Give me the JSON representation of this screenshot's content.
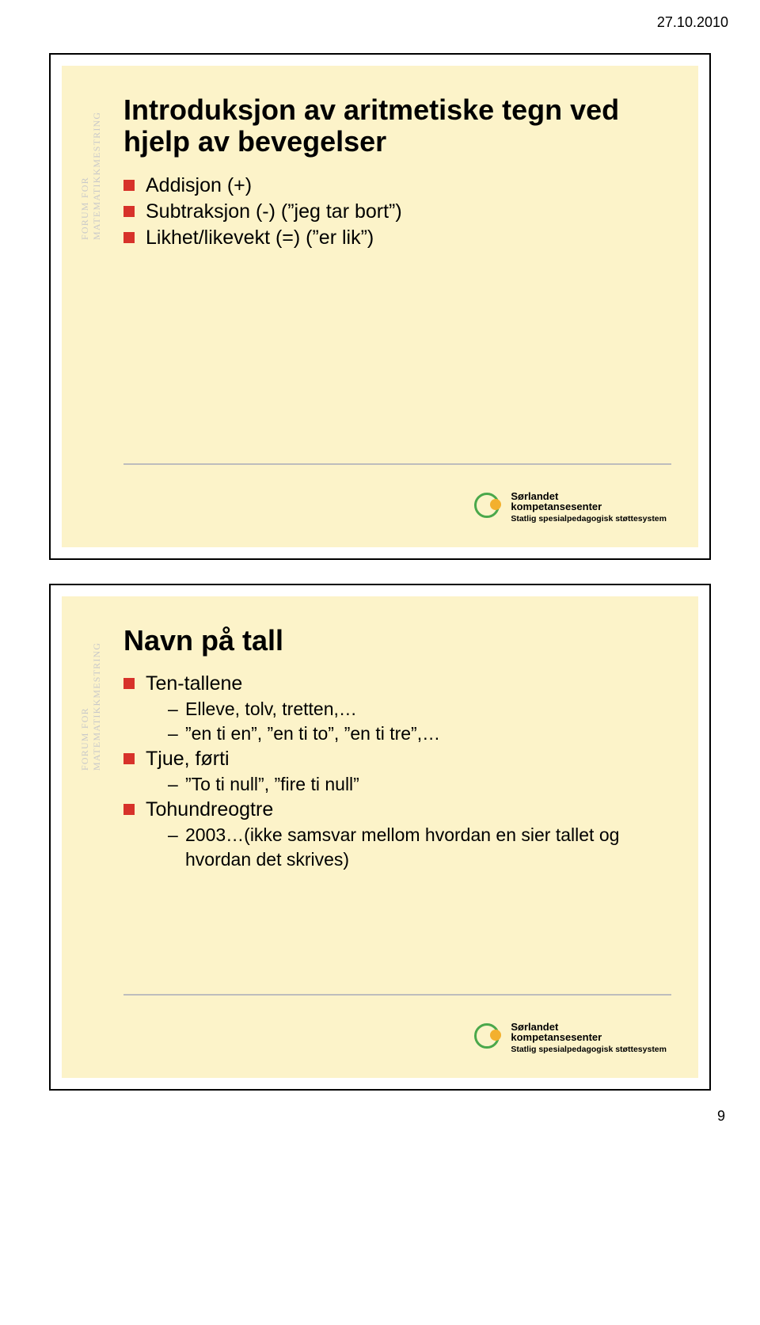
{
  "header_date": "27.10.2010",
  "vertical_label": "FORUM FOR MATEMATIKKMESTRING",
  "logo": {
    "line1": "Sørlandet",
    "line2": "kompetansesenter",
    "line3": "Statlig spesialpedagogisk støttesystem"
  },
  "page_number": "9",
  "slide1": {
    "title": "Introduksjon av aritmetiske tegn ved hjelp av bevegelser",
    "items": [
      {
        "text": "Addisjon (+)"
      },
      {
        "text": "Subtraksjon (-) (”jeg tar bort”)"
      },
      {
        "text": "Likhet/likevekt (=) (”er lik”)"
      }
    ]
  },
  "slide2": {
    "title": "Navn på tall",
    "items": [
      {
        "text": "Ten-tallene",
        "subs": [
          "Elleve, tolv, tretten,…",
          "”en ti en”, ”en ti to”, ”en ti tre”,…"
        ]
      },
      {
        "text": "Tjue, førti",
        "subs": [
          "”To ti null”, ”fire ti null”"
        ]
      },
      {
        "text": "Tohundreogtre",
        "subs": [
          "2003…(ikke samsvar mellom hvordan en sier tallet og hvordan det skrives)"
        ]
      }
    ]
  }
}
